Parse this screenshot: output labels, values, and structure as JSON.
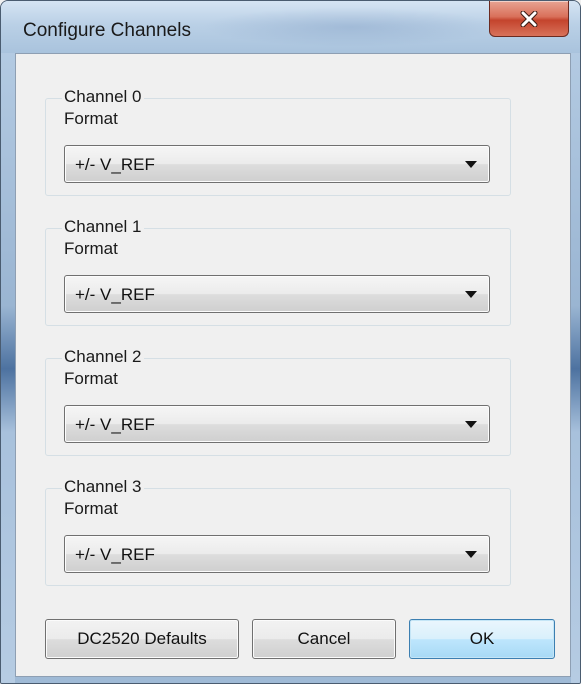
{
  "window": {
    "title": "Configure Channels",
    "close_label": "close"
  },
  "channels": [
    {
      "title": "Channel 0",
      "format_label": "Format",
      "value": "+/- V_REF"
    },
    {
      "title": "Channel 1",
      "format_label": "Format",
      "value": "+/- V_REF"
    },
    {
      "title": "Channel 2",
      "format_label": "Format",
      "value": "+/- V_REF"
    },
    {
      "title": "Channel 3",
      "format_label": "Format",
      "value": "+/- V_REF"
    }
  ],
  "buttons": {
    "defaults": "DC2520 Defaults",
    "cancel": "Cancel",
    "ok": "OK"
  },
  "icons": {
    "close": "close-icon",
    "dropdown": "chevron-down-icon"
  },
  "colors": {
    "close_button": "#c4442d",
    "default_button_border": "#3c7fb1"
  }
}
